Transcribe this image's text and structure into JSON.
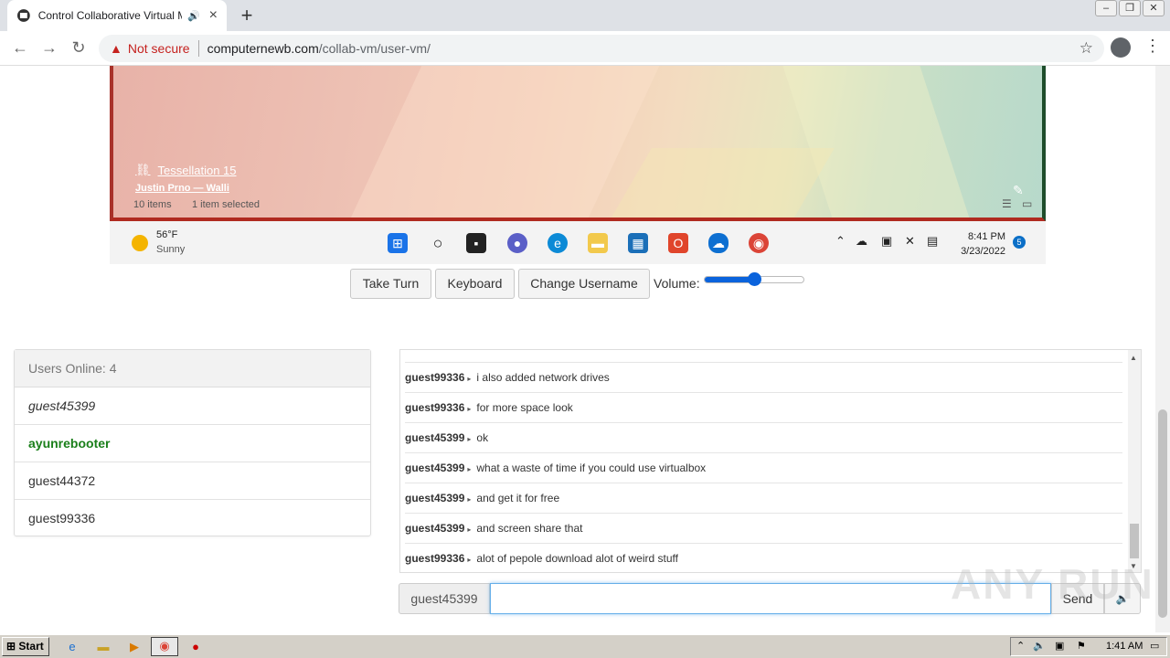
{
  "browser": {
    "tab_title": "Control Collaborative Virtual Ma",
    "not_secure": "Not secure",
    "url_domain": "computernewb.com",
    "url_path": "/collab-vm/user-vm/"
  },
  "vm": {
    "wallpaper_title": "Tessellation 15",
    "wallpaper_author": "Justin Prno — Walli",
    "items": "10 items",
    "selected": "1 item selected",
    "weather_temp": "56°F",
    "weather_cond": "Sunny",
    "time": "8:41 PM",
    "date": "3/23/2022",
    "notifications": "5"
  },
  "controls": {
    "take_turn": "Take Turn",
    "keyboard": "Keyboard",
    "change_username": "Change Username",
    "volume_label": "Volume:",
    "volume_level": 0.5
  },
  "users": {
    "header": "Users Online: 4",
    "list": [
      "guest45399",
      "ayunrebooter",
      "guest44372",
      "guest99336"
    ]
  },
  "chat": {
    "messages": [
      {
        "user": "guest99336",
        "text": "i also added network drives"
      },
      {
        "user": "guest99336",
        "text": "for more space look"
      },
      {
        "user": "guest45399",
        "text": "ok"
      },
      {
        "user": "guest45399",
        "text": "what a waste of time if you could use virtualbox"
      },
      {
        "user": "guest45399",
        "text": "and get it for free"
      },
      {
        "user": "guest45399",
        "text": "and screen share that"
      },
      {
        "user": "guest99336",
        "text": "alot of pepole download alot of weird stuff"
      }
    ],
    "username": "guest45399",
    "input_value": "",
    "send": "Send"
  },
  "watermark": "ANY RUN",
  "os_taskbar": {
    "start": "Start",
    "time": "1:41 AM"
  }
}
